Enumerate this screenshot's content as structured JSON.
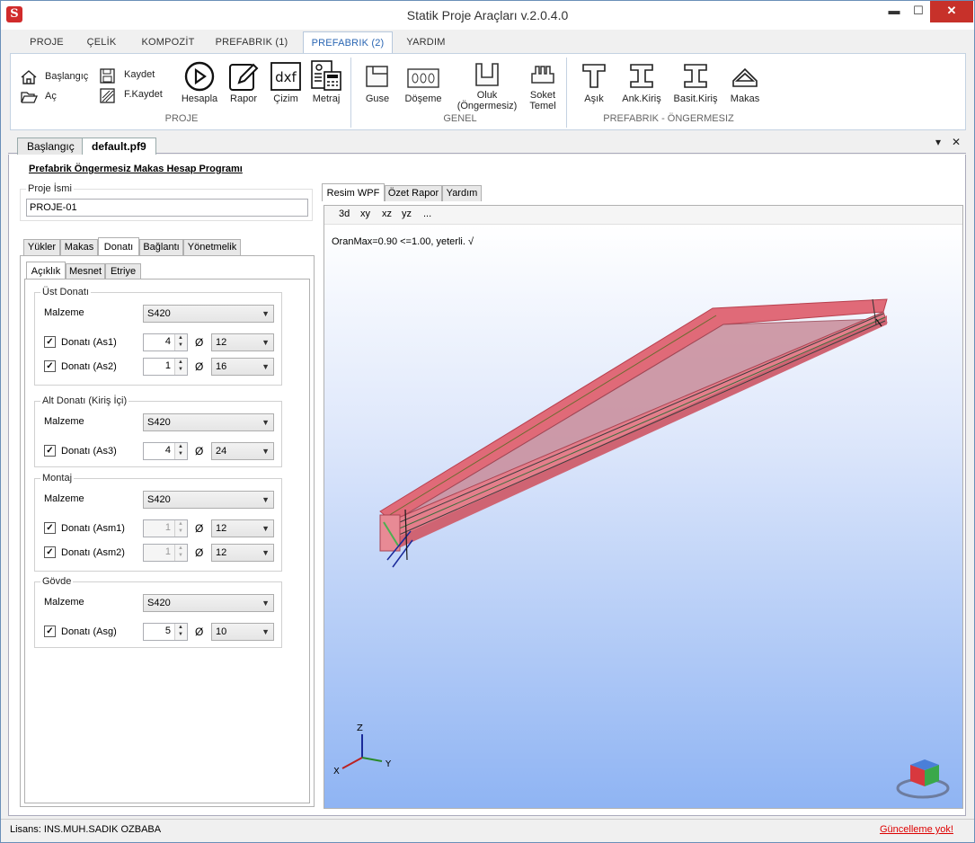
{
  "window": {
    "title": "Statik Proje Araçları v.2.0.4.0",
    "min": "▬",
    "max": "☐",
    "close": "✕"
  },
  "ribbon_tabs": [
    "PROJE",
    "ÇELİK",
    "KOMPOZİT",
    "PREFABRIK (1)",
    "PREFABRIK (2)",
    "YARDIM"
  ],
  "active_ribbon_tab": "PREFABRIK (2)",
  "ribbon": {
    "proje": {
      "start": "Başlangıç",
      "open": "Aç",
      "save": "Kaydet",
      "save_as": "F.Kaydet",
      "calc": "Hesapla",
      "report": "Rapor",
      "draw": "Çizim",
      "dxf": "dxf",
      "quantity": "Metraj",
      "group": "PROJE"
    },
    "genel": {
      "guse": "Guse",
      "doseme": "Döşeme",
      "oluk1": "Oluk",
      "oluk2": "(Öngermesiz)",
      "soket1": "Soket",
      "soket2": "Temel",
      "group": "GENEL"
    },
    "prefab": {
      "asik": "Aşık",
      "ank": "Ank.Kiriş",
      "basit": "Basit.Kiriş",
      "makas": "Makas",
      "group": "PREFABRIK - ÖNGERMESIZ"
    }
  },
  "doc_tabs": [
    "Başlangıç",
    "default.pf9"
  ],
  "doc_ctrl": {
    "dropdown": "▾",
    "close": "✕"
  },
  "heading": "Prefabrik Öngermesiz Makas Hesap Programı",
  "project": {
    "legend": "Proje İsmi",
    "value": "PROJE-01"
  },
  "main_tabs": [
    "Yükler",
    "Makas",
    "Donatı",
    "Bağlantı",
    "Yönetmelik"
  ],
  "sub_tabs": [
    "Açıklık",
    "Mesnet",
    "Etriye"
  ],
  "groups": {
    "ust": {
      "legend": "Üst Donatı",
      "malzeme_lbl": "Malzeme",
      "malzeme": "S420",
      "rows": [
        {
          "label": "Donatı (As1)",
          "count": "4",
          "dia": "12",
          "checked": true
        },
        {
          "label": "Donatı (As2)",
          "count": "1",
          "dia": "16",
          "checked": true
        }
      ]
    },
    "alt": {
      "legend": "Alt Donatı (Kiriş İçi)",
      "malzeme_lbl": "Malzeme",
      "malzeme": "S420",
      "rows": [
        {
          "label": "Donatı (As3)",
          "count": "4",
          "dia": "24",
          "checked": true
        }
      ]
    },
    "montaj": {
      "legend": "Montaj",
      "malzeme_lbl": "Malzeme",
      "malzeme": "S420",
      "rows": [
        {
          "label": "Donatı (Asm1)",
          "count": "1",
          "dia": "12",
          "checked": true
        },
        {
          "label": "Donatı (Asm2)",
          "count": "1",
          "dia": "12",
          "checked": true
        }
      ]
    },
    "govde": {
      "legend": "Gövde",
      "malzeme_lbl": "Malzeme",
      "malzeme": "S420",
      "rows": [
        {
          "label": "Donatı (Asg)",
          "count": "5",
          "dia": "10",
          "checked": true
        }
      ]
    }
  },
  "phi": "Ø",
  "viewer": {
    "tabs": [
      "Resim WPF",
      "Özet Rapor",
      "Yardım"
    ],
    "toolbar": [
      "3d",
      "xy",
      "xz",
      "yz",
      "..."
    ],
    "ratio_text": "OranMax=0.90 <=1.00, yeterli. √",
    "axes": {
      "z": "Z",
      "x": "X",
      "y": "Y"
    }
  },
  "status": {
    "license": "Lisans: INS.MUH.SADIK OZBABA",
    "update": "Güncelleme yok!"
  },
  "colors": {
    "accent": "#2a66b3",
    "beam": "#e06a78",
    "close_btn": "#c7312a"
  }
}
